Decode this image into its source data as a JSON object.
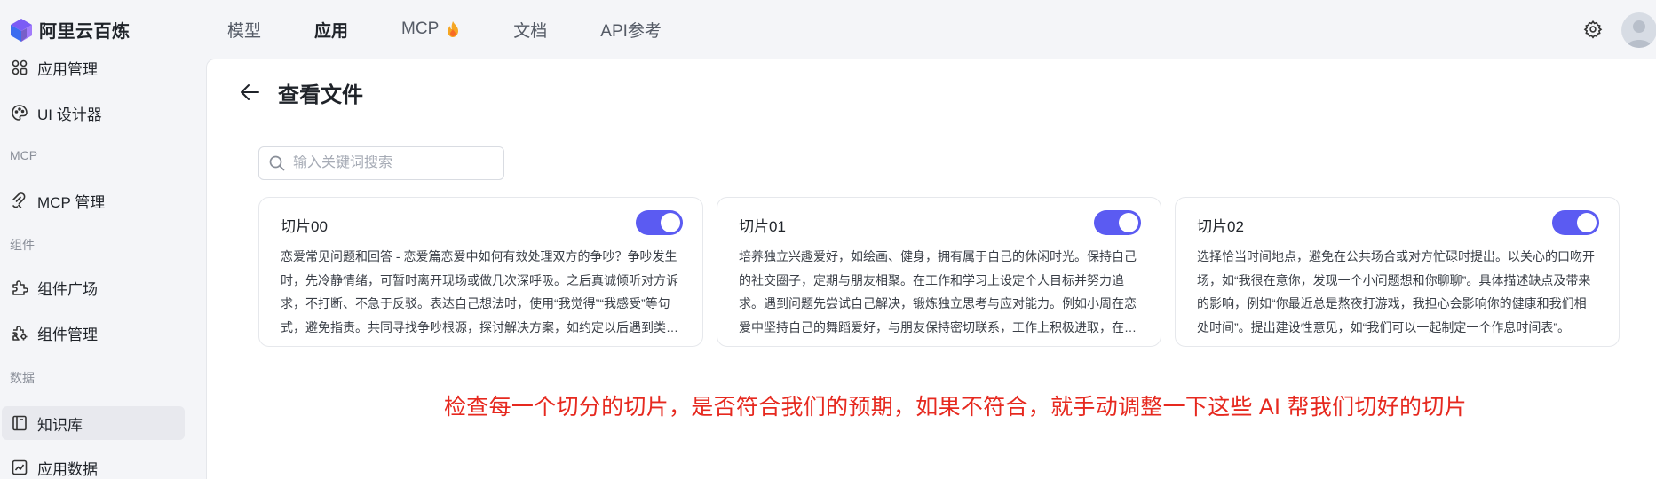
{
  "app": {
    "name": "阿里云百炼"
  },
  "nav": {
    "items": [
      {
        "label": "模型",
        "active": false
      },
      {
        "label": "应用",
        "active": true
      },
      {
        "label": "MCP",
        "active": false,
        "icon": "fire-icon"
      },
      {
        "label": "文档",
        "active": false
      },
      {
        "label": "API参考",
        "active": false
      }
    ]
  },
  "sidebar": {
    "items": [
      {
        "label": "应用管理",
        "icon": "apps-icon"
      },
      {
        "label": "UI 设计器",
        "icon": "palette-icon"
      },
      {
        "label": "MCP 管理",
        "icon": "mcp-icon"
      },
      {
        "label": "组件广场",
        "icon": "puzzle-icon"
      },
      {
        "label": "组件管理",
        "icon": "puzzle-gear-icon"
      },
      {
        "label": "知识库",
        "icon": "book-icon",
        "active": true
      },
      {
        "label": "应用数据",
        "icon": "chart-icon"
      }
    ],
    "groups": [
      "MCP",
      "组件",
      "数据"
    ]
  },
  "page": {
    "title": "查看文件",
    "search_placeholder": "输入关键词搜索"
  },
  "chunks": [
    {
      "title": "切片00",
      "enabled": true,
      "text": "恋爱常见问题和回答 - 恋爱篇恋爱中如何有效处理双方的争吵？争吵发生时，先冷静情绪，可暂时离开现场或做几次深呼吸。之后真诚倾听对方诉求，不打断、不急于反驳。表达自己想法时，使用“我觉得”“我感受”等句式，避免指责。共同寻找争吵根源，探讨解决方案，如约定以后遇到类似情况的处理方式。"
    },
    {
      "title": "切片01",
      "enabled": true,
      "text": "培养独立兴趣爱好，如绘画、健身，拥有属于自己的休闲时光。保持自己的社交圈子，定期与朋友相聚。在工作和学习上设定个人目标并努力追求。遇到问题先尝试自己解决，锻炼独立思考与应对能力。例如小周在恋爱中坚持自己的舞蹈爱好，与朋友保持密切联系，工作上积极进取，在感情中保持独立。"
    },
    {
      "title": "切片02",
      "enabled": true,
      "text": "选择恰当时间地点，避免在公共场合或对方忙碌时提出。以关心的口吻开场，如“我很在意你，发现一个小问题想和你聊聊”。具体描述缺点及带来的影响，例如“你最近总是熬夜打游戏，我担心会影响你的健康和我们相处时间”。提出建设性意见，如“我们可以一起制定一个作息时间表”。"
    }
  ],
  "annotation": "检查每一个切分的切片，是否符合我们的预期，如果不符合，就手动调整一下这些 AI 帮我们切好的切片",
  "colors": {
    "accent": "#5b5bf2",
    "annotation": "#e6291f"
  }
}
